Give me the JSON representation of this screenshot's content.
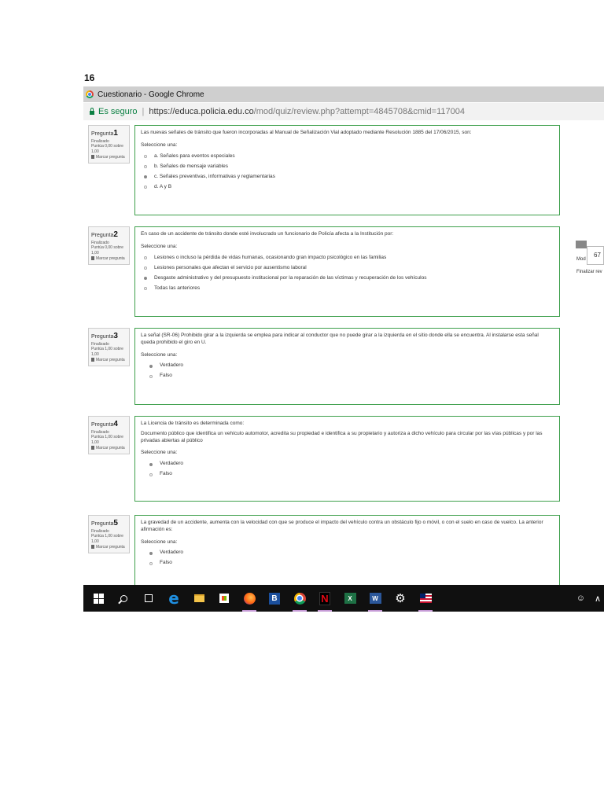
{
  "page_number": "16",
  "window": {
    "title": "Cuestionario - Google Chrome"
  },
  "address": {
    "secure_label": "Es seguro",
    "separator": "|",
    "url_scheme_host": "https://educa.policia.edu.co",
    "url_path": "/mod/quiz/review.php?attempt=4845708&cmid=117004"
  },
  "side": {
    "number": "67",
    "mod": "Mod",
    "finalizar": "Finalizar rev"
  },
  "questions": [
    {
      "label": "Pregunta",
      "number": "1",
      "state": "Finalizado",
      "score": "Puntúa 0,00 sobre 1,00",
      "flag": "Marcar pregunta",
      "text": "Las nuevas señales de tránsito que fueron incorporadas al Manual de Señalización Vial adoptado mediante Resolución 1885 del 17/06/2015, son:",
      "statement": "",
      "select_label": "Seleccione una:",
      "options": [
        "a. Señales para eventos especiales",
        "b. Señales de mensaje variables",
        "c. Señales preventivas, informativas y reglamentarias",
        "d. A y B"
      ],
      "selected": 2
    },
    {
      "label": "Pregunta",
      "number": "2",
      "state": "Finalizado",
      "score": "Puntúa 0,00 sobre 1,00",
      "flag": "Marcar pregunta",
      "text": "En caso de un accidente de tránsito donde esté involucrado un funcionario de Policía afecta a la Institución por:",
      "statement": "",
      "select_label": "Seleccione una:",
      "options": [
        "Lesiones o incluso la pérdida de vidas humanas, ocasionando gran impacto psicológico en las familias",
        "Lesiones personales que afectan el servicio por ausentismo laboral",
        "Desgaste administrativo y del presupuesto institucional por la reparación de las víctimas y recuperación de los vehículos",
        "Todas las anteriores"
      ],
      "selected": 2
    },
    {
      "label": "Pregunta",
      "number": "3",
      "state": "Finalizado",
      "score": "Puntúa 1,00 sobre 1,00",
      "flag": "Marcar pregunta",
      "text": "La señal (SR-06) Prohibido girar a la izquierda se emplea para indicar al conductor que no puede girar a la izquierda en el sitio donde ella se encuentra. Al instalarse esta señal queda prohibido el giro en U.",
      "statement": "",
      "select_label": "Seleccione una:",
      "options": [
        "Verdadero",
        "Falso"
      ],
      "selected": 0
    },
    {
      "label": "Pregunta",
      "number": "4",
      "state": "Finalizado",
      "score": "Puntúa 1,00 sobre 1,00",
      "flag": "Marcar pregunta",
      "text": "La Licencia de tránsito es determinada como:",
      "statement": "Documento público que identifica un vehículo automotor, acredita su propiedad e identifica a su propietario y autoriza a dicho vehículo para circular por las vías públicas y por las privadas abiertas al público",
      "select_label": "Seleccione una:",
      "options": [
        "Verdadero",
        "Falso"
      ],
      "selected": 0
    },
    {
      "label": "Pregunta",
      "number": "5",
      "state": "Finalizado",
      "score": "Puntúa 1,00 sobre 1,00",
      "flag": "Marcar pregunta",
      "text": "La gravedad de un accidente, aumenta con la velocidad con que se produce el impacto del vehículo contra un obstáculo fijo o móvil, o con el suelo en caso de vuelco. La anterior afirmación es:",
      "statement": "",
      "select_label": "Seleccione una:",
      "options": [
        "Verdadero",
        "Falso"
      ],
      "selected": 0
    }
  ],
  "taskbar": {
    "icons": [
      "windows-start-icon",
      "search-icon",
      "task-view-icon",
      "edge-icon",
      "file-explorer-icon",
      "store-icon",
      "firefox-icon",
      "b-app-icon",
      "chrome-icon",
      "netflix-icon",
      "excel-icon",
      "word-icon",
      "settings-icon",
      "flag-app-icon"
    ],
    "b_letter": "B",
    "netflix_letter": "N",
    "excel_letter": "X",
    "word_letter": "W"
  }
}
